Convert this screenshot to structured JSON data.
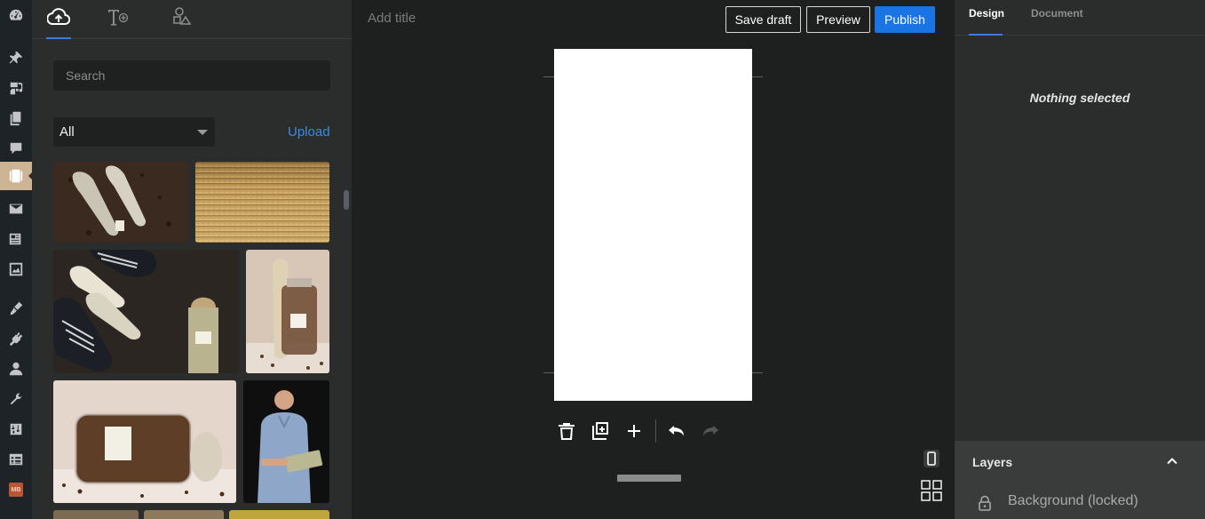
{
  "rail": {
    "items": [
      {
        "name": "dashboard-icon"
      },
      {
        "name": "pin-icon"
      },
      {
        "name": "media-icon"
      },
      {
        "name": "pages-icon"
      },
      {
        "name": "comments-icon"
      },
      {
        "name": "stories-icon",
        "active": true
      },
      {
        "name": "mail-icon"
      },
      {
        "name": "newspaper-icon"
      },
      {
        "name": "image-gallery-icon"
      },
      {
        "name": "appearance-icon"
      },
      {
        "name": "plugins-icon"
      },
      {
        "name": "users-icon"
      },
      {
        "name": "tools-icon"
      },
      {
        "name": "settings-icon"
      },
      {
        "name": "table-icon"
      },
      {
        "name": "mb-plugin-icon",
        "label": "MB"
      }
    ]
  },
  "library": {
    "tabs": [
      {
        "name": "upload-media-icon"
      },
      {
        "name": "text-add-icon"
      },
      {
        "name": "shapes-icon"
      }
    ],
    "search_placeholder": "Search",
    "filter_value": "All",
    "upload_label": "Upload",
    "media": [
      {
        "name": "insoles-on-coffee-thumb"
      },
      {
        "name": "woven-texture-thumb"
      },
      {
        "name": "shoes-and-insoles-thumb"
      },
      {
        "name": "coffee-jar-standing-thumb"
      },
      {
        "name": "coffee-jar-lying-thumb"
      },
      {
        "name": "man-holding-product-thumb"
      }
    ]
  },
  "editor": {
    "title_placeholder": "Add title",
    "save_draft_label": "Save draft",
    "preview_label": "Preview",
    "publish_label": "Publish",
    "colors": {
      "accent": "#1b74e4",
      "panel": "#2b2c2c",
      "workspace": "#1e1f1f"
    }
  },
  "inspector": {
    "tab_design": "Design",
    "tab_document": "Document",
    "empty_message": "Nothing selected",
    "layers_title": "Layers",
    "layer_background": "Background (locked)"
  }
}
